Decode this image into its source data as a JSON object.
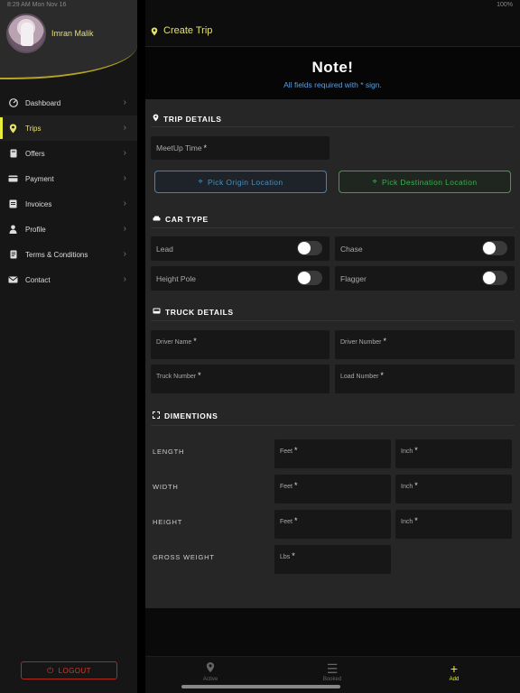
{
  "status_bar": {
    "time": "8:29 AM  Mon Nov 16",
    "battery": "100%"
  },
  "profile": {
    "name": "Imran Malik"
  },
  "menu": [
    {
      "label": "Dashboard",
      "icon": "dashboard-icon"
    },
    {
      "label": "Trips",
      "icon": "location-pin-icon",
      "active": true
    },
    {
      "label": "Offers",
      "icon": "offers-icon"
    },
    {
      "label": "Payment",
      "icon": "payment-card-icon"
    },
    {
      "label": "Invoices",
      "icon": "invoice-icon"
    },
    {
      "label": "Profile",
      "icon": "person-icon"
    },
    {
      "label": "Terms & Conditions",
      "icon": "document-icon"
    },
    {
      "label": "Contact",
      "icon": "mail-icon"
    }
  ],
  "logout_label": "LOGOUT",
  "header": {
    "title": "Create Trip"
  },
  "note": {
    "heading": "Note!",
    "text_before": "All fields required with",
    "star": "*",
    "text_after": "sign."
  },
  "trip_details": {
    "title": "TRIP DETAILS",
    "meetup_label": "MeetUp Time",
    "origin_button": "Pick Origin Location",
    "destination_button": "Pick Destination Location"
  },
  "car_type": {
    "title": "CAR TYPE",
    "options": [
      {
        "label": "Lead",
        "on": false
      },
      {
        "label": "Chase",
        "on": false
      },
      {
        "label": "Height Pole",
        "on": false
      },
      {
        "label": "Flagger",
        "on": false
      }
    ]
  },
  "truck_details": {
    "title": "TRUCK DETAILS",
    "driver_name": "Driver Name",
    "driver_number": "Driver Number",
    "truck_number": "Truck Number",
    "load_number": "Load Number"
  },
  "dimensions": {
    "title": "DIMENTIONS",
    "length": "LENGTH",
    "width": "WIDTH",
    "height": "HEIGHT",
    "gross_weight": "GROSS WEIGHT",
    "feet": "Feet",
    "inch": "Inch",
    "lbs": "Lbs"
  },
  "tabs": [
    {
      "label": "Active",
      "icon": "location-pin-icon"
    },
    {
      "label": "Booked",
      "icon": "list-icon"
    },
    {
      "label": "Add",
      "icon": "plus-icon",
      "active": true
    }
  ],
  "colors": {
    "accent": "#e8ef3a",
    "origin": "#3d93cc",
    "destination": "#39b04d",
    "logout": "#d23a2e"
  }
}
